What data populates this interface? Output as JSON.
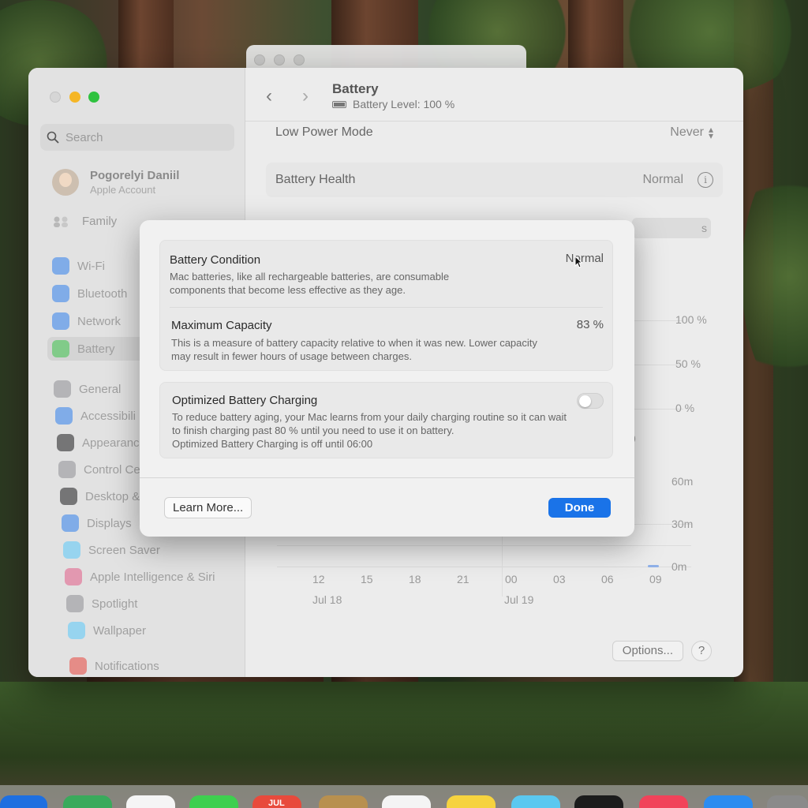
{
  "sidebar": {
    "search_placeholder": "Search",
    "account": {
      "name": "Pogorelyi Daniil",
      "subtitle": "Apple Account"
    },
    "family_label": "Family",
    "items": [
      {
        "label": "Wi-Fi",
        "icon": "wifi-icon",
        "color": "#2f80ed"
      },
      {
        "label": "Bluetooth",
        "icon": "bluetooth-icon",
        "color": "#2f80ed"
      },
      {
        "label": "Network",
        "icon": "globe-icon",
        "color": "#2f80ed"
      },
      {
        "label": "Battery",
        "icon": "battery-icon",
        "color": "#3cc24a"
      },
      {
        "label": "General",
        "icon": "gear-icon",
        "color": "#8e8e93"
      },
      {
        "label": "Accessibili",
        "icon": "accessibility-icon",
        "color": "#2f80ed"
      },
      {
        "label": "Appearanc",
        "icon": "appearance-icon",
        "color": "#1c1c1e"
      },
      {
        "label": "Control Ce",
        "icon": "control-center-icon",
        "color": "#8e8e93"
      },
      {
        "label": "Desktop &",
        "icon": "desktop-icon",
        "color": "#1c1c1e"
      },
      {
        "label": "Displays",
        "icon": "displays-icon",
        "color": "#2f80ed"
      },
      {
        "label": "Screen Saver",
        "icon": "screen-saver-icon",
        "color": "#5ac8fa"
      },
      {
        "label": "Apple Intelligence & Siri",
        "icon": "siri-icon",
        "color": "#e25b86"
      },
      {
        "label": "Spotlight",
        "icon": "spotlight-icon",
        "color": "#8e8e93"
      },
      {
        "label": "Wallpaper",
        "icon": "wallpaper-icon",
        "color": "#5ac8fa"
      },
      {
        "label": "Notifications",
        "icon": "notifications-icon",
        "color": "#e8453c"
      }
    ]
  },
  "toolbar": {
    "title": "Battery",
    "subtitle": "Battery Level: 100 %"
  },
  "settings": {
    "low_power_label": "Low Power Mode",
    "low_power_value": "Never",
    "health_label": "Battery Health",
    "health_value": "Normal",
    "tab_partial": "s"
  },
  "chart": {
    "level_ticks": [
      "100 %",
      "50 %",
      "0 %"
    ],
    "usage_ticks": [
      "60m",
      "30m",
      "0m"
    ],
    "hour_labels": [
      "12",
      "15",
      "18",
      "21",
      "00",
      "03",
      "06",
      "09"
    ],
    "date_labels": [
      "Jul 18",
      "Jul 19"
    ],
    "partial_hour": "9"
  },
  "footer": {
    "options_label": "Options...",
    "help_label": "?"
  },
  "sheet": {
    "condition_title": "Battery Condition",
    "condition_value": "Normal",
    "condition_desc": "Mac batteries, like all rechargeable batteries, are consumable components that become less effective as they age.",
    "capacity_title": "Maximum Capacity",
    "capacity_value": "83 %",
    "capacity_desc": "This is a measure of battery capacity relative to when it was new. Lower capacity may result in fewer hours of usage between charges.",
    "optimized_title": "Optimized Battery Charging",
    "optimized_desc_1": "To reduce battery aging, your Mac learns from your daily charging routine so it can wait to finish charging past 80 % until you need to use it on battery.",
    "optimized_desc_2": "Optimized Battery Charging is off until 06:00",
    "optimized_enabled": false,
    "learn_more_label": "Learn More...",
    "done_label": "Done"
  },
  "dock": {
    "calendar_month": "JUL"
  },
  "colors": {
    "accent": "#1a73e8",
    "traffic_min": "#f5b626",
    "traffic_max": "#2fc23f"
  }
}
